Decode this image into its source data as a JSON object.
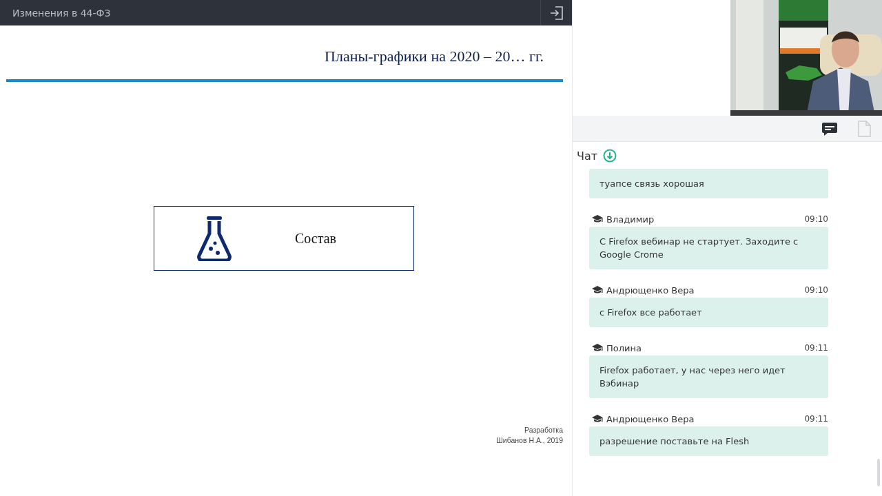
{
  "header": {
    "title": "Изменения в 44-ФЗ"
  },
  "slide": {
    "title": "Планы-графики на 2020 – 20… гг.",
    "card_label": "Состав",
    "credit_lines": [
      "Разработка",
      "Шибанов Н.А., 2019"
    ]
  },
  "panel_tabs": [
    {
      "kind": "chat",
      "selected": true
    },
    {
      "kind": "documents",
      "selected": false
    }
  ],
  "chat": {
    "title": "Чат",
    "messages": [
      {
        "text": "туапсе связь хорошая"
      },
      {
        "author": "Владимир",
        "time": "09:10",
        "text": "С Firefox вебинар не стартует. Заходите с Google Crome"
      },
      {
        "author": "Андрющенко Вера",
        "time": "09:10",
        "text": "с Firefox все работает"
      },
      {
        "author": "Полина",
        "time": "09:11",
        "text": "Firefox работает, у нас через него идет Вэбинар"
      },
      {
        "author": "Андрющенко Вера",
        "time": "09:11",
        "text": "разрешение поставьте на Flesh"
      }
    ]
  }
}
